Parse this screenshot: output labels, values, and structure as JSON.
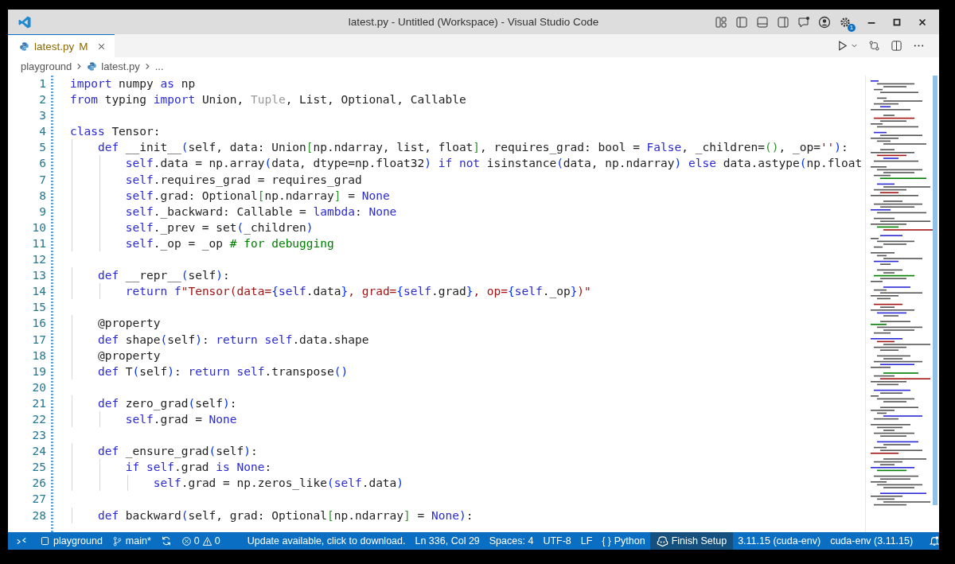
{
  "title_bar": {
    "title": "latest.py - Untitled (Workspace) - Visual Studio Code",
    "settings_badge": "1"
  },
  "tabs": [
    {
      "label": "latest.py",
      "status": "M",
      "selected": true
    }
  ],
  "breadcrumbs": [
    {
      "kind": "folder",
      "text": "playground"
    },
    {
      "kind": "file",
      "text": "latest.py"
    },
    {
      "kind": "more",
      "text": "..."
    }
  ],
  "editor": {
    "lines": [
      {
        "number": "1",
        "tokens": [
          {
            "kind": "keyword",
            "text": "import"
          },
          {
            "kind": "plain",
            "text": " numpy "
          },
          {
            "kind": "keyword",
            "text": "as"
          },
          {
            "kind": "plain",
            "text": " np"
          }
        ]
      },
      {
        "number": "2",
        "tokens": [
          {
            "kind": "keyword",
            "text": "from"
          },
          {
            "kind": "plain",
            "text": " typing "
          },
          {
            "kind": "keyword",
            "text": "import"
          },
          {
            "kind": "plain",
            "text": " Union, "
          },
          {
            "kind": "unused",
            "text": "Tuple"
          },
          {
            "kind": "plain",
            "text": ", List, Optional, Callable"
          }
        ]
      },
      {
        "number": "3"
      },
      {
        "number": "4",
        "tokens": [
          {
            "kind": "keyword",
            "text": "class"
          },
          {
            "kind": "plain",
            "text": " Tensor:"
          }
        ]
      },
      {
        "number": "5",
        "tokens": [
          {
            "kind": "keyword",
            "text": "    def"
          },
          {
            "kind": "plain",
            "text": " __init__"
          },
          {
            "kind": "paren",
            "text": "("
          },
          {
            "kind": "plain",
            "text": "self, data: Union"
          },
          {
            "kind": "bracket",
            "text": "["
          },
          {
            "kind": "plain",
            "text": "np.ndarray, list, float"
          },
          {
            "kind": "bracket",
            "text": "]"
          },
          {
            "kind": "plain",
            "text": ", requires_grad: bool = "
          },
          {
            "kind": "keyword",
            "text": "False"
          },
          {
            "kind": "plain",
            "text": ", _children="
          },
          {
            "kind": "bracket",
            "text": "()"
          },
          {
            "kind": "plain",
            "text": ", _op="
          },
          {
            "kind": "string",
            "text": "''"
          },
          {
            "kind": "paren",
            "text": ")"
          },
          {
            "kind": "plain",
            "text": ":"
          }
        ]
      },
      {
        "number": "6",
        "tokens": [
          {
            "kind": "keyword",
            "text": "        self"
          },
          {
            "kind": "plain",
            "text": ".data = np.array"
          },
          {
            "kind": "paren",
            "text": "("
          },
          {
            "kind": "plain",
            "text": "data, dtype=np.float32"
          },
          {
            "kind": "paren",
            "text": ")"
          },
          {
            "kind": "keyword",
            "text": " if not"
          },
          {
            "kind": "plain",
            "text": " isinstance"
          },
          {
            "kind": "paren",
            "text": "("
          },
          {
            "kind": "plain",
            "text": "data, np.ndarray"
          },
          {
            "kind": "paren",
            "text": ")"
          },
          {
            "kind": "keyword",
            "text": " else"
          },
          {
            "kind": "plain",
            "text": " data.astype"
          },
          {
            "kind": "paren",
            "text": "("
          },
          {
            "kind": "plain",
            "text": "np.float"
          }
        ]
      },
      {
        "number": "7",
        "tokens": [
          {
            "kind": "keyword",
            "text": "        self"
          },
          {
            "kind": "plain",
            "text": ".requires_grad = requires_grad"
          }
        ]
      },
      {
        "number": "8",
        "tokens": [
          {
            "kind": "keyword",
            "text": "        self"
          },
          {
            "kind": "plain",
            "text": ".grad: Optional"
          },
          {
            "kind": "bracket",
            "text": "["
          },
          {
            "kind": "plain",
            "text": "np.ndarray"
          },
          {
            "kind": "bracket",
            "text": "]"
          },
          {
            "kind": "plain",
            "text": " = "
          },
          {
            "kind": "keyword",
            "text": "None"
          }
        ]
      },
      {
        "number": "9",
        "tokens": [
          {
            "kind": "keyword",
            "text": "        self"
          },
          {
            "kind": "plain",
            "text": "._backward: Callable = "
          },
          {
            "kind": "keyword",
            "text": "lambda"
          },
          {
            "kind": "plain",
            "text": ": "
          },
          {
            "kind": "keyword",
            "text": "None"
          }
        ]
      },
      {
        "number": "10",
        "tokens": [
          {
            "kind": "keyword",
            "text": "        self"
          },
          {
            "kind": "plain",
            "text": "._prev = set"
          },
          {
            "kind": "paren",
            "text": "("
          },
          {
            "kind": "plain",
            "text": "_children"
          },
          {
            "kind": "paren",
            "text": ")"
          }
        ]
      },
      {
        "number": "11",
        "tokens": [
          {
            "kind": "keyword",
            "text": "        self"
          },
          {
            "kind": "plain",
            "text": "._op = _op "
          },
          {
            "kind": "comment",
            "text": "# for debugging"
          }
        ]
      },
      {
        "number": "12"
      },
      {
        "number": "13",
        "tokens": [
          {
            "kind": "keyword",
            "text": "    def"
          },
          {
            "kind": "plain",
            "text": " __repr__"
          },
          {
            "kind": "paren",
            "text": "("
          },
          {
            "kind": "plain",
            "text": "self"
          },
          {
            "kind": "paren",
            "text": ")"
          },
          {
            "kind": "plain",
            "text": ":"
          }
        ]
      },
      {
        "number": "14",
        "tokens": [
          {
            "kind": "keyword",
            "text": "        return f"
          },
          {
            "kind": "string",
            "text": "\"Tensor(data="
          },
          {
            "kind": "paren",
            "text": "{"
          },
          {
            "kind": "keyword",
            "text": "self"
          },
          {
            "kind": "plain",
            "text": ".data"
          },
          {
            "kind": "paren",
            "text": "}"
          },
          {
            "kind": "string",
            "text": ", grad="
          },
          {
            "kind": "paren",
            "text": "{"
          },
          {
            "kind": "keyword",
            "text": "self"
          },
          {
            "kind": "plain",
            "text": ".grad"
          },
          {
            "kind": "paren",
            "text": "}"
          },
          {
            "kind": "string",
            "text": ", op="
          },
          {
            "kind": "paren",
            "text": "{"
          },
          {
            "kind": "keyword",
            "text": "self"
          },
          {
            "kind": "plain",
            "text": "._op"
          },
          {
            "kind": "paren",
            "text": "}"
          },
          {
            "kind": "string",
            "text": ")\""
          }
        ]
      },
      {
        "number": "15"
      },
      {
        "number": "16",
        "tokens": [
          {
            "kind": "plain",
            "text": "    @property"
          }
        ]
      },
      {
        "number": "17",
        "tokens": [
          {
            "kind": "keyword",
            "text": "    def"
          },
          {
            "kind": "plain",
            "text": " shape"
          },
          {
            "kind": "paren",
            "text": "("
          },
          {
            "kind": "plain",
            "text": "self"
          },
          {
            "kind": "paren",
            "text": ")"
          },
          {
            "kind": "plain",
            "text": ": "
          },
          {
            "kind": "keyword",
            "text": "return self"
          },
          {
            "kind": "plain",
            "text": ".data.shape"
          }
        ]
      },
      {
        "number": "18",
        "tokens": [
          {
            "kind": "plain",
            "text": "    @property"
          }
        ]
      },
      {
        "number": "19",
        "tokens": [
          {
            "kind": "keyword",
            "text": "    def"
          },
          {
            "kind": "plain",
            "text": " T"
          },
          {
            "kind": "paren",
            "text": "("
          },
          {
            "kind": "plain",
            "text": "self"
          },
          {
            "kind": "paren",
            "text": ")"
          },
          {
            "kind": "plain",
            "text": ": "
          },
          {
            "kind": "keyword",
            "text": "return self"
          },
          {
            "kind": "plain",
            "text": ".transpose"
          },
          {
            "kind": "paren",
            "text": "()"
          }
        ]
      },
      {
        "number": "20"
      },
      {
        "number": "21",
        "tokens": [
          {
            "kind": "keyword",
            "text": "    def"
          },
          {
            "kind": "plain",
            "text": " zero_grad"
          },
          {
            "kind": "paren",
            "text": "("
          },
          {
            "kind": "plain",
            "text": "self"
          },
          {
            "kind": "paren",
            "text": ")"
          },
          {
            "kind": "plain",
            "text": ":"
          }
        ]
      },
      {
        "number": "22",
        "tokens": [
          {
            "kind": "keyword",
            "text": "        self"
          },
          {
            "kind": "plain",
            "text": ".grad = "
          },
          {
            "kind": "keyword",
            "text": "None"
          }
        ]
      },
      {
        "number": "23"
      },
      {
        "number": "24",
        "tokens": [
          {
            "kind": "keyword",
            "text": "    def"
          },
          {
            "kind": "plain",
            "text": " _ensure_grad"
          },
          {
            "kind": "paren",
            "text": "("
          },
          {
            "kind": "plain",
            "text": "self"
          },
          {
            "kind": "paren",
            "text": ")"
          },
          {
            "kind": "plain",
            "text": ":"
          }
        ]
      },
      {
        "number": "25",
        "tokens": [
          {
            "kind": "keyword",
            "text": "        if self"
          },
          {
            "kind": "plain",
            "text": ".grad "
          },
          {
            "kind": "keyword",
            "text": "is None"
          },
          {
            "kind": "plain",
            "text": ":"
          }
        ]
      },
      {
        "number": "26",
        "tokens": [
          {
            "kind": "keyword",
            "text": "            self"
          },
          {
            "kind": "plain",
            "text": ".grad = np.zeros_like"
          },
          {
            "kind": "paren",
            "text": "("
          },
          {
            "kind": "keyword",
            "text": "self"
          },
          {
            "kind": "plain",
            "text": ".data"
          },
          {
            "kind": "paren",
            "text": ")"
          }
        ]
      },
      {
        "number": "27"
      },
      {
        "number": "28",
        "tokens": [
          {
            "kind": "keyword",
            "text": "    def"
          },
          {
            "kind": "plain",
            "text": " backward"
          },
          {
            "kind": "paren",
            "text": "("
          },
          {
            "kind": "plain",
            "text": "self, grad: Optional"
          },
          {
            "kind": "bracket",
            "text": "["
          },
          {
            "kind": "plain",
            "text": "np.ndarray"
          },
          {
            "kind": "bracket",
            "text": "]"
          },
          {
            "kind": "plain",
            "text": " = "
          },
          {
            "kind": "keyword",
            "text": "None"
          },
          {
            "kind": "paren",
            "text": ")"
          },
          {
            "kind": "plain",
            "text": ":"
          }
        ]
      }
    ]
  },
  "status_bar": {
    "items": [
      {
        "kind": "remote"
      },
      {
        "kind": "workspace",
        "text": "playground"
      },
      {
        "kind": "branch",
        "text": "main*"
      },
      {
        "kind": "sync"
      },
      {
        "kind": "problems",
        "errors": "0",
        "warnings": "0"
      },
      {
        "kind": "update",
        "text": "Update available, click to download."
      },
      {
        "kind": "position",
        "text": "Ln 336, Col 29"
      },
      {
        "kind": "spaces",
        "text": "Spaces: 4"
      },
      {
        "kind": "encoding",
        "text": "UTF-8"
      },
      {
        "kind": "eol",
        "text": "LF"
      },
      {
        "kind": "language",
        "icon": "{ }",
        "text": "Python"
      },
      {
        "kind": "setup",
        "text": "Finish Setup"
      },
      {
        "kind": "interpreter",
        "text": "3.11.15 (cuda-env)"
      },
      {
        "kind": "env",
        "text": "cuda-env (3.11.15)"
      },
      {
        "kind": "notifications"
      }
    ]
  }
}
